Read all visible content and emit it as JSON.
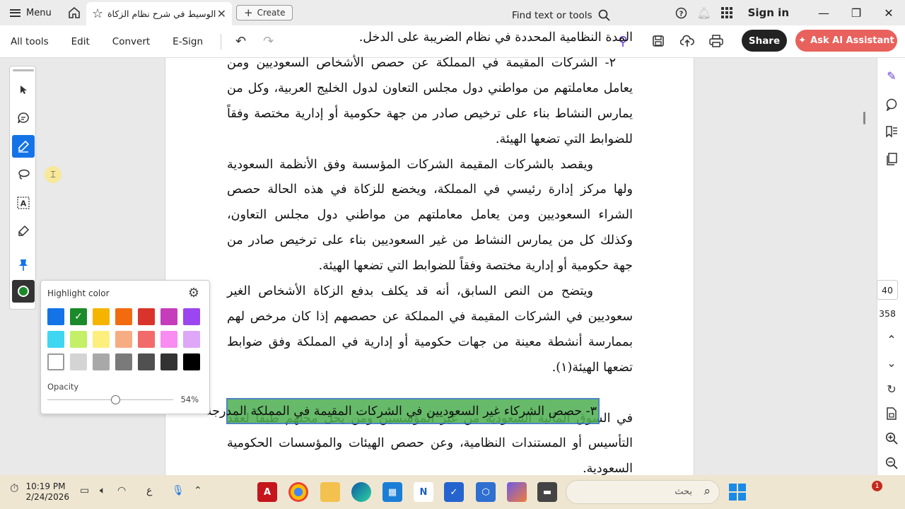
{
  "titlebar": {
    "menu_label": "Menu",
    "tab_title": "الوسيط في شرح نظام الزكاة ..",
    "create_label": "Create",
    "signin_label": "Sign in"
  },
  "toolbar": {
    "items": [
      "All tools",
      "Edit",
      "Convert",
      "E-Sign"
    ],
    "find_label": "Find text or tools",
    "share_label": "Share",
    "ai_label": "Ask AI Assistant"
  },
  "document": {
    "lines": [
      "المدة النظامية المحددة في نظام الضريبة على الدخل.",
      "٢- الشركات المقيمة في المملكة عن حصص الأشخاص السعوديين ومن يعامل معاملتهم من مواطني دول مجلس التعاون لدول الخليج العربية، وكل من يمارس النشاط بناء على ترخيص صادر من جهة حكومية أو إدارية مختصة وفقاً للضوابط التي تضعها الهيئة.",
      "ويقصد بالشركات المقيمة الشركات المؤسسة وفق الأنظمة السعودية ولها مركز إدارة رئيسي في المملكة، ويخضع للزكاة في هذه الحالة حصص الشراء السعوديين ومن يعامل معاملتهم من مواطني دول مجلس التعاون، وكذلك كل من يمارس النشاط من غير السعوديين بناء على ترخيص صادر من جهة حكومية أو إدارية مختصة وفقاً للضوابط التي تضعها الهيئة.",
      "ويتضح من النص السابق، أنه قد يكلف بدفع الزكاة الأشخاص الغير سعوديين في الشركات المقيمة في المملكة عن حصصهم إذا كان مرخص لهم بممارسة أنشطة معينة من جهات حكومية أو إدارية في المملكة وفق ضوابط تضعها الهيئة(١).",
      "٣- حصص الشركاء غير السعوديين في الشركات المقيمة في المملكة المدرجة",
      "في السوق المالية السعودية من غير المؤسسين ومن يحل محلهم طبقاً لعقد التأسيس أو المستندات النظامية، وعن حصص الهيئات والمؤسسات الحكومية السعودية."
    ]
  },
  "highlight_popup": {
    "title": "Highlight color",
    "colors": [
      "#1473e6",
      "#1b8a2a",
      "#f5b400",
      "#f26b0f",
      "#d9342b",
      "#c53dbb",
      "#9b46f0",
      "#3fd6f2",
      "#c3f066",
      "#fcef7e",
      "#f7ad84",
      "#f36a6a",
      "#f88cf0",
      "#dea7f7",
      "#ffffff",
      "#d4d4d4",
      "#a8a8a8",
      "#7a7a7a",
      "#505050",
      "#333333",
      "#000000"
    ],
    "selected_color": "#1b8a2a",
    "opacity_label": "Opacity",
    "opacity_value": "54%",
    "opacity_fraction": 0.54
  },
  "tools": {
    "icons": [
      "select-arrow-icon",
      "comment-icon",
      "highlight-pen-icon",
      "lasso-icon",
      "text-box-icon",
      "fill-sign-icon",
      "pin-icon",
      "color-swatch-icon"
    ],
    "active_tool": "highlight-pen-icon"
  },
  "rail": {
    "page_number": "40",
    "total_pages": "358"
  },
  "taskbar": {
    "time": "10:19 PM",
    "date": "2/24/2026",
    "lang": "ع",
    "search_placeholder": "بحث",
    "notification_count": "1"
  }
}
